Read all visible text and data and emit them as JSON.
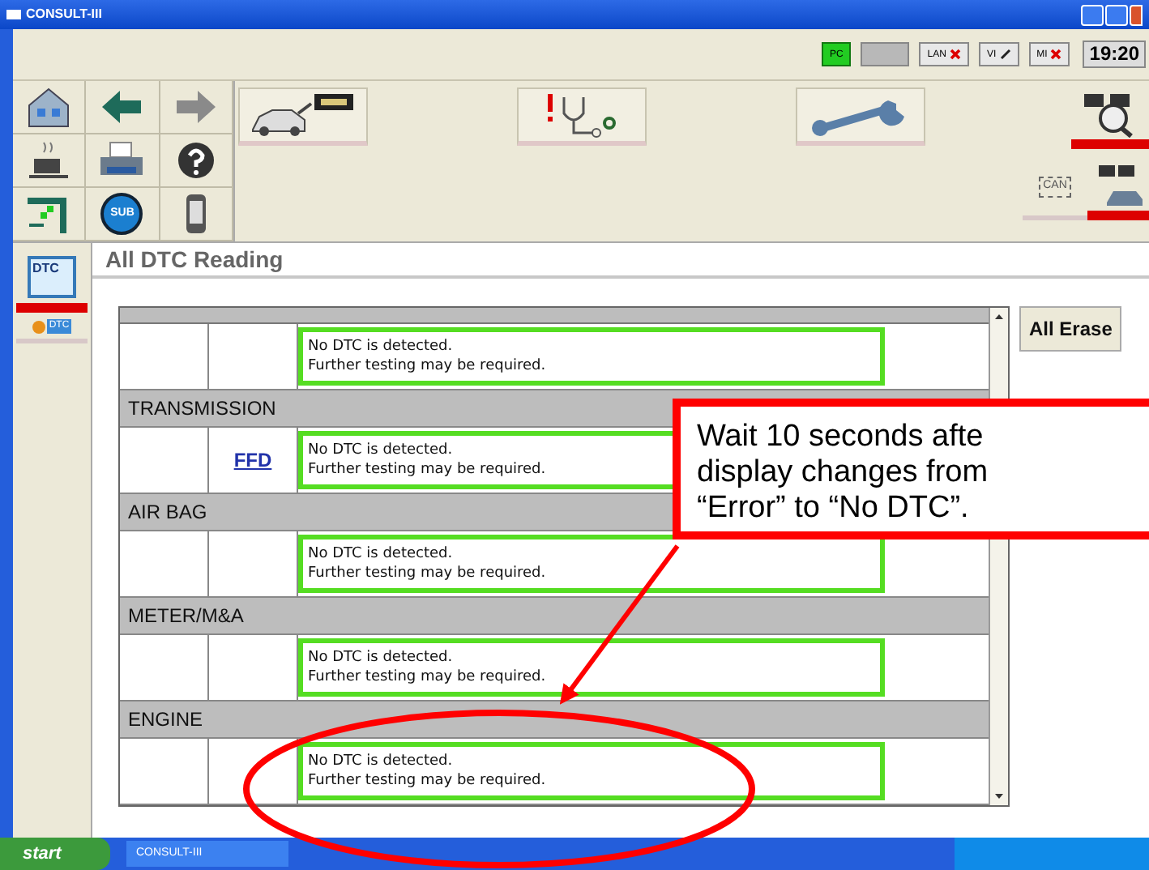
{
  "window": {
    "title": "CONSULT-III"
  },
  "status_bar": {
    "indicators": [
      {
        "label": "PC",
        "kind": "ok"
      },
      {
        "kind": "blank"
      },
      {
        "label": "LAN",
        "kind": "error"
      },
      {
        "label": "VI",
        "kind": "link"
      },
      {
        "label": "MI",
        "kind": "error"
      }
    ],
    "time": "19:20"
  },
  "toolbar": {
    "grid": [
      {
        "kind": "home"
      },
      {
        "kind": "back"
      },
      {
        "kind": "forward"
      },
      {
        "kind": "cup"
      },
      {
        "kind": "printer"
      },
      {
        "kind": "help"
      },
      {
        "kind": "network"
      },
      {
        "kind": "sub",
        "label": "SUB"
      },
      {
        "kind": "phone"
      }
    ],
    "buttons": [
      {
        "kind": "car-display"
      },
      {
        "kind": "stethoscope"
      },
      {
        "kind": "wrench"
      }
    ],
    "right": [
      {
        "kind": "flag-search",
        "selected": true
      },
      {
        "kind": "can",
        "label": "CAN",
        "selected": false
      },
      {
        "kind": "flag-car",
        "selected": true
      }
    ]
  },
  "sidebar": {
    "items": [
      {
        "kind": "dtc",
        "label": "DTC",
        "selected": true
      },
      {
        "kind": "dtc-link",
        "label": "DTC",
        "selected": false
      }
    ]
  },
  "page": {
    "title": "All DTC Reading"
  },
  "table": {
    "rows": [
      {
        "kind": "header"
      },
      {
        "kind": "result",
        "message_lines": [
          "No DTC is detected.",
          "Further testing may be required."
        ]
      },
      {
        "kind": "header",
        "label": "TRANSMISSION"
      },
      {
        "kind": "result",
        "link": "FFD",
        "message_lines": [
          "No DTC is detected.",
          "Further testing may be required."
        ]
      },
      {
        "kind": "header",
        "label": "AIR BAG"
      },
      {
        "kind": "result",
        "message_lines": [
          "No DTC is detected.",
          "Further testing may be required."
        ]
      },
      {
        "kind": "header",
        "label": "METER/M&A"
      },
      {
        "kind": "result",
        "message_lines": [
          "No DTC is detected.",
          "Further testing may be required."
        ]
      },
      {
        "kind": "header",
        "label": "ENGINE"
      },
      {
        "kind": "result",
        "message_lines": [
          "No DTC is detected.",
          "Further testing may be required."
        ]
      }
    ]
  },
  "erase_button": "All Erase",
  "callout": {
    "lines": [
      "Wait 10 seconds afte",
      "display changes from",
      "“Error” to “No DTC”."
    ]
  },
  "taskbar": {
    "start": "start",
    "tasks": [
      "CONSULT-III"
    ]
  }
}
